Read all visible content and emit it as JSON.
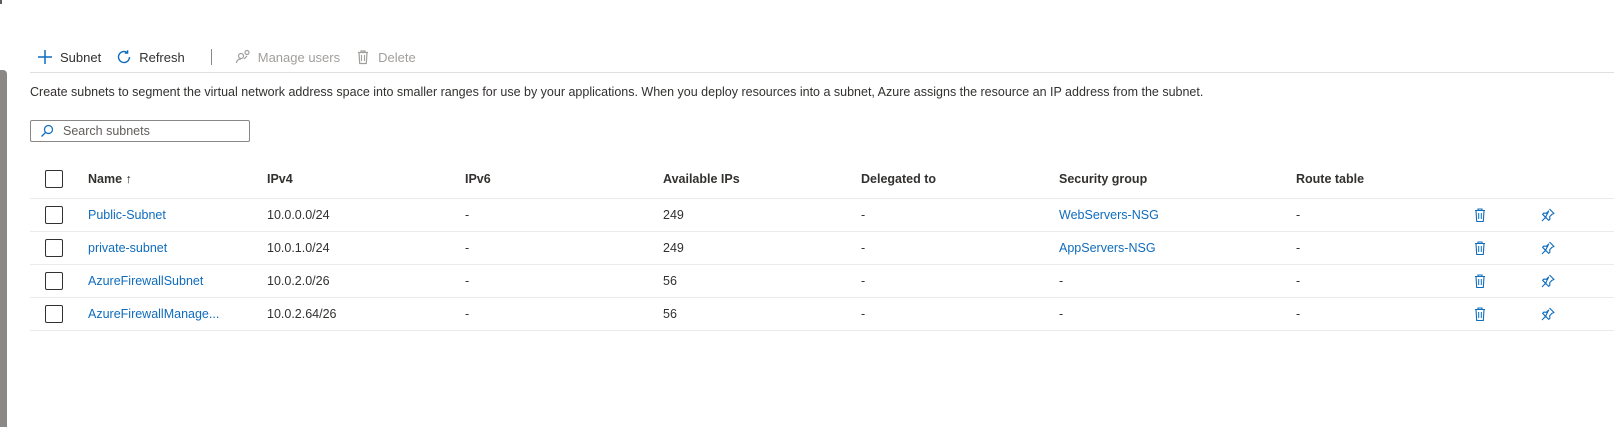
{
  "toolbar": {
    "add_subnet_label": "Subnet",
    "refresh_label": "Refresh",
    "manage_users_label": "Manage users",
    "delete_label": "Delete"
  },
  "description": "Create subnets to segment the virtual network address space into smaller ranges for use by your applications. When you deploy resources into a subnet, Azure assigns the resource an IP address from the subnet.",
  "search": {
    "placeholder": "Search subnets",
    "value": ""
  },
  "table": {
    "columns": {
      "name": "Name ↑",
      "ipv4": "IPv4",
      "ipv6": "IPv6",
      "available_ips": "Available IPs",
      "delegated_to": "Delegated to",
      "security_group": "Security group",
      "route_table": "Route table"
    },
    "rows": [
      {
        "name": "Public-Subnet",
        "ipv4": "10.0.0.0/24",
        "ipv6": "-",
        "available_ips": "249",
        "delegated_to": "-",
        "security_group": "WebServers-NSG",
        "route_table": "-"
      },
      {
        "name": "private-subnet",
        "ipv4": "10.0.1.0/24",
        "ipv6": "-",
        "available_ips": "249",
        "delegated_to": "-",
        "security_group": "AppServers-NSG",
        "route_table": "-"
      },
      {
        "name": "AzureFirewallSubnet",
        "ipv4": "10.0.2.0/26",
        "ipv6": "-",
        "available_ips": "56",
        "delegated_to": "-",
        "security_group": "-",
        "route_table": "-"
      },
      {
        "name": "AzureFirewallManage...",
        "ipv4": "10.0.2.64/26",
        "ipv6": "-",
        "available_ips": "56",
        "delegated_to": "-",
        "security_group": "-",
        "route_table": "-"
      }
    ]
  },
  "icons": {
    "add": "plus-icon",
    "refresh": "refresh-icon",
    "manage_users": "manage-users-icon",
    "delete": "trash-icon",
    "search": "search-icon",
    "pin": "pin-icon"
  },
  "colors": {
    "link": "#0f6cbd",
    "text": "#323130",
    "disabled": "#a19f9d",
    "border": "#edebe9"
  }
}
